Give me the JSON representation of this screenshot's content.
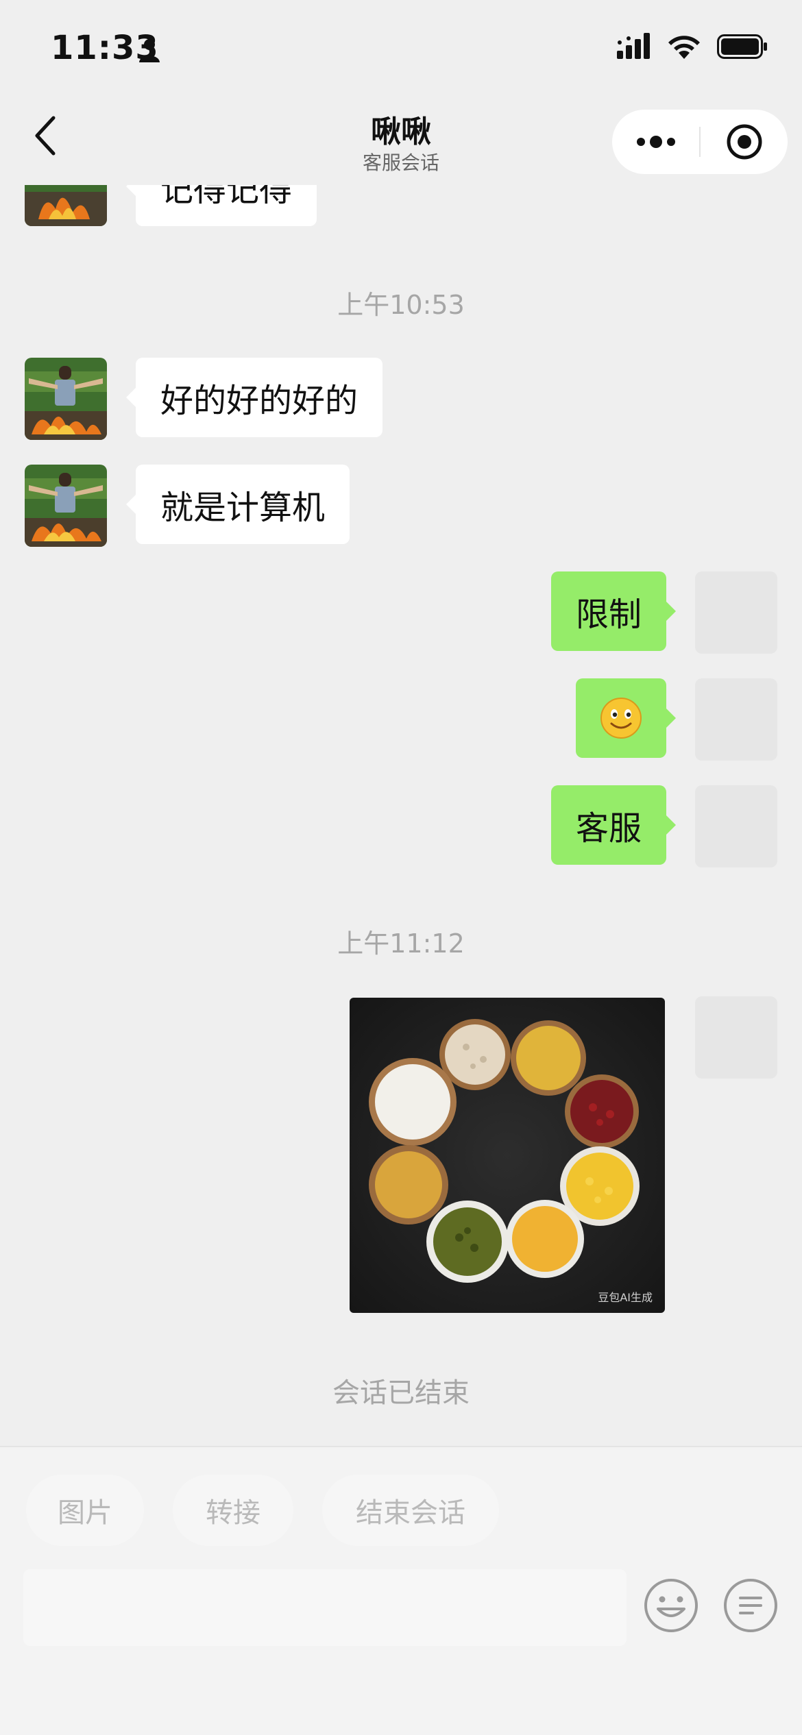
{
  "status_bar": {
    "time": "11:33"
  },
  "nav": {
    "title": "啾啾",
    "subtitle": "客服会话"
  },
  "messages": {
    "partial_top": "记得记得",
    "time_1": "上午10:53",
    "in_1": "好的好的好的",
    "in_2": "就是计算机",
    "out_1": "限制",
    "out_2": "🙂",
    "out_3": "客服",
    "time_2": "上午11:12",
    "image_watermark": "豆包AI生成",
    "session_ended": "会话已结束"
  },
  "bottom": {
    "quick_actions": [
      "图片",
      "转接",
      "结束会话"
    ]
  },
  "icons": {
    "back": "chevron-left-icon",
    "more": "more-dots-icon",
    "close": "target-close-icon",
    "emoji": "emoji-icon",
    "menu": "menu-lines-icon"
  },
  "colors": {
    "incoming_bubble": "#ffffff",
    "outgoing_bubble": "#95ec69",
    "background": "#efefef"
  }
}
